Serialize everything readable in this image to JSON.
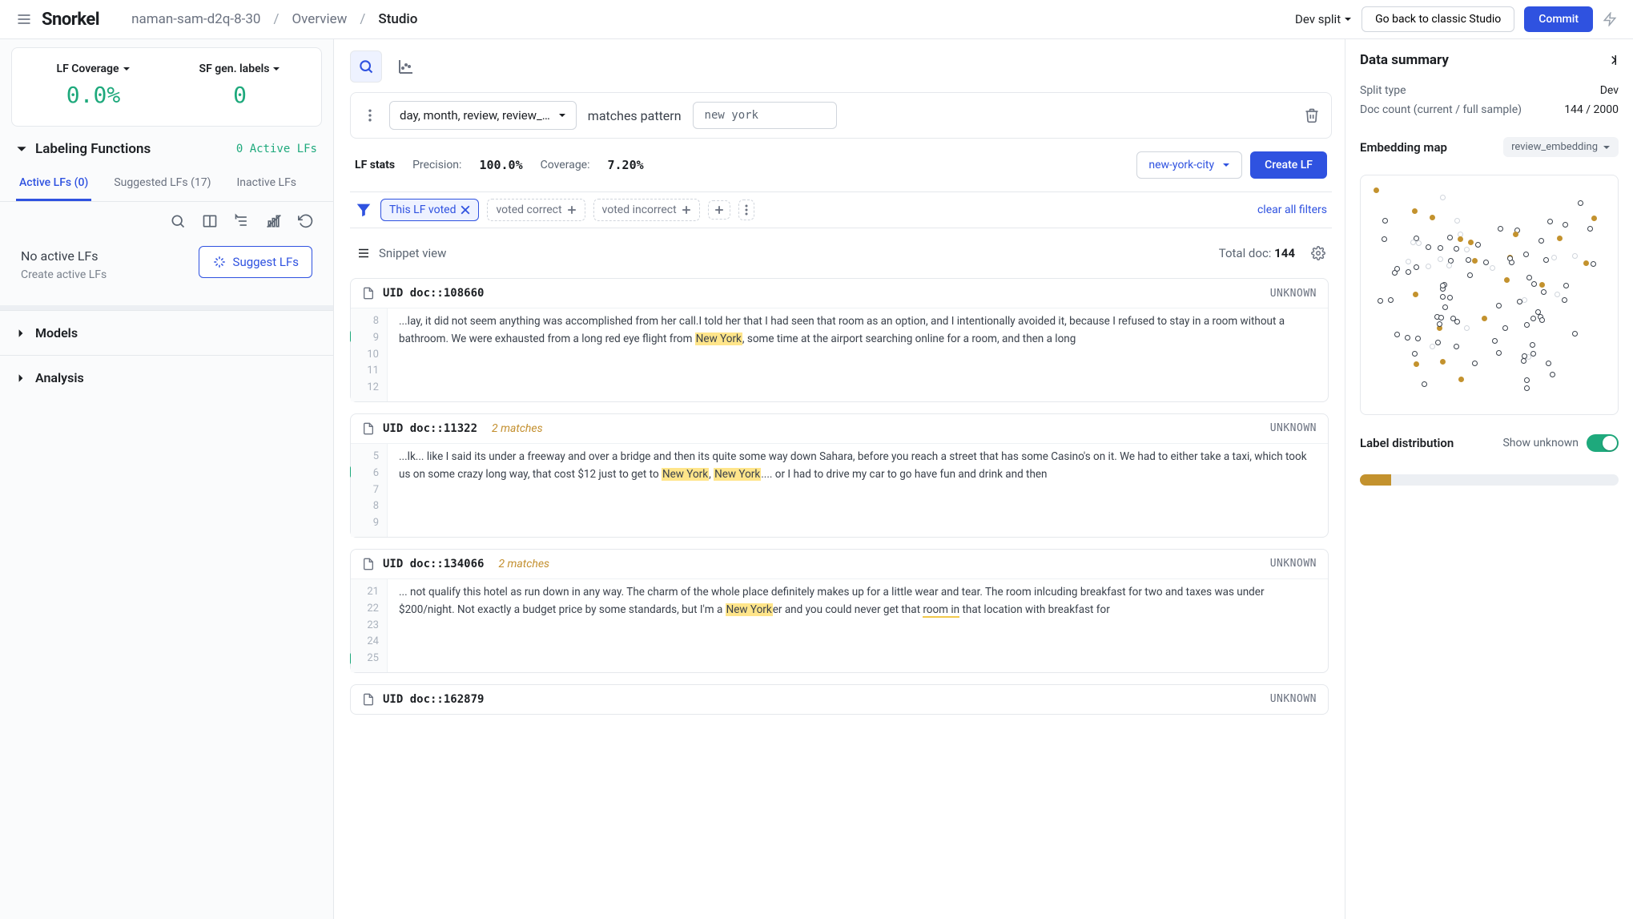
{
  "header": {
    "logo": "Snorkel",
    "project": "naman-sam-d2q-8-30",
    "crumb_overview": "Overview",
    "crumb_studio": "Studio",
    "dev_split": "Dev split",
    "classic_btn": "Go back to classic Studio",
    "commit_btn": "Commit"
  },
  "metrics": {
    "lf_coverage_label": "LF Coverage",
    "lf_coverage_value": "0.0%",
    "sf_gen_label": "SF gen. labels",
    "sf_gen_value": "0"
  },
  "left": {
    "lf_section": "Labeling Functions",
    "active_count": "0 Active LFs",
    "tabs": {
      "active": "Active LFs (0)",
      "suggested": "Suggested LFs (17)",
      "inactive": "Inactive LFs"
    },
    "empty_title": "No active LFs",
    "empty_sub": "Create active LFs",
    "suggest_btn": "Suggest LFs",
    "models": "Models",
    "analysis": "Analysis"
  },
  "query": {
    "fields": "day, month, review, review_…",
    "op": "matches pattern",
    "pattern": "new york"
  },
  "stats": {
    "head": "LF stats",
    "precision_lbl": "Precision:",
    "precision_val": "100.0%",
    "coverage_lbl": "Coverage:",
    "coverage_val": "7.20%",
    "label_value": "new-york-city",
    "create_btn": "Create LF"
  },
  "filters": {
    "voted": "This LF voted",
    "correct": "voted correct",
    "incorrect": "voted incorrect",
    "clear": "clear all filters"
  },
  "snippet": {
    "label": "Snippet view",
    "total_label": "Total doc:",
    "total_value": "144"
  },
  "docs": [
    {
      "uid": "UID doc::108660",
      "matches": "",
      "status": "UNKNOWN",
      "lines": [
        "8",
        "9",
        "10",
        "11",
        "12"
      ],
      "tick_at": 1,
      "segments": [
        {
          "t": "...lay, it did not seem anything was accomplished from her call.I told her that I had seen that room as an option, and I intentionally avoided it, because I refused to stay in a room without a bathroom. We were exhausted from a long red eye flight from "
        },
        {
          "t": "New York",
          "hl": true
        },
        {
          "t": ", some time at the airport searching online for a room, and then a long"
        }
      ]
    },
    {
      "uid": "UID doc::11322",
      "matches": "2 matches",
      "status": "UNKNOWN",
      "lines": [
        "5",
        "6",
        "7",
        "8",
        "9"
      ],
      "tick_at": 1,
      "segments": [
        {
          "t": "...lk... like I said its under a freeway and over a bridge and then its quite some way down Sahara, before you reach a street that has some Casino's on it. We had to either take a taxi, which took us on some crazy long way, that cost $12 just to get to "
        },
        {
          "t": "New York",
          "hl": true
        },
        {
          "t": ", "
        },
        {
          "t": "New York",
          "hl": true
        },
        {
          "t": ".... or I had to drive my car to go have fun and drink and then"
        }
      ]
    },
    {
      "uid": "UID doc::134066",
      "matches": "2 matches",
      "status": "UNKNOWN",
      "lines": [
        "21",
        "22",
        "23",
        "24",
        "25"
      ],
      "tick_at": 4,
      "segments": [
        {
          "t": "... not qualify this hotel as run down in any way. The charm of the whole place definitely makes up for a little wear and tear. The room inlcuding breakfast for two and taxes was under $200/night. Not exactly a budget price by some standards, but I'm a "
        },
        {
          "t": "New York",
          "hl": true
        },
        {
          "t": "er and you could never get that "
        },
        {
          "t": "room in",
          "ul": true
        },
        {
          "t": " that location with breakfast for"
        }
      ]
    },
    {
      "uid": "UID doc::162879",
      "matches": "",
      "status": "UNKNOWN",
      "lines": [],
      "segments": []
    }
  ],
  "right": {
    "title": "Data summary",
    "split_type_k": "Split type",
    "split_type_v": "Dev",
    "doc_count_k": "Doc count (current / full sample)",
    "doc_count_v": "144 / 2000",
    "embed_title": "Embedding map",
    "embed_select": "review_embedding",
    "dist_title": "Label distribution",
    "show_unknown": "Show unknown"
  },
  "chart_data": {
    "type": "scatter",
    "title": "Embedding map",
    "series": [
      {
        "name": "unlabeled",
        "count_approx": 90
      },
      {
        "name": "new-york-city",
        "count_approx": 20
      }
    ],
    "note": "2D embedding projection; exact coordinates not labeled"
  }
}
